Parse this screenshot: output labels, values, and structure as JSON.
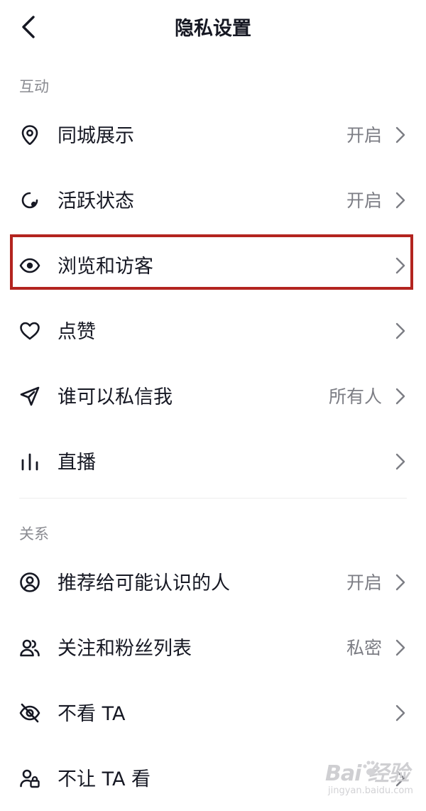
{
  "header": {
    "title": "隐私设置"
  },
  "sections": {
    "interaction": "互动",
    "relations": "关系"
  },
  "rows": [
    {
      "label": "同城展示",
      "value": "开启"
    },
    {
      "label": "活跃状态",
      "value": "开启"
    },
    {
      "label": "浏览和访客",
      "value": ""
    },
    {
      "label": "点赞",
      "value": ""
    },
    {
      "label": "谁可以私信我",
      "value": "所有人"
    },
    {
      "label": "直播",
      "value": ""
    },
    {
      "label": "推荐给可能认识的人",
      "value": "开启"
    },
    {
      "label": "关注和粉丝列表",
      "value": "私密"
    },
    {
      "label": "不看 TA",
      "value": ""
    },
    {
      "label": "不让 TA 看",
      "value": ""
    }
  ],
  "icons": [
    "location-pin-icon",
    "active-status-icon",
    "eye-icon",
    "heart-icon",
    "paper-plane-icon",
    "live-bars-icon",
    "user-circle-icon",
    "users-icon",
    "eye-slash-icon",
    "user-lock-icon"
  ],
  "watermark": {
    "main": "Bai 经验",
    "sub": "jingyan.baidu.com"
  },
  "colors": {
    "text": "#161823",
    "secondary": "#7c7d84",
    "section": "#8a8b91",
    "highlight": "#b3241f"
  }
}
